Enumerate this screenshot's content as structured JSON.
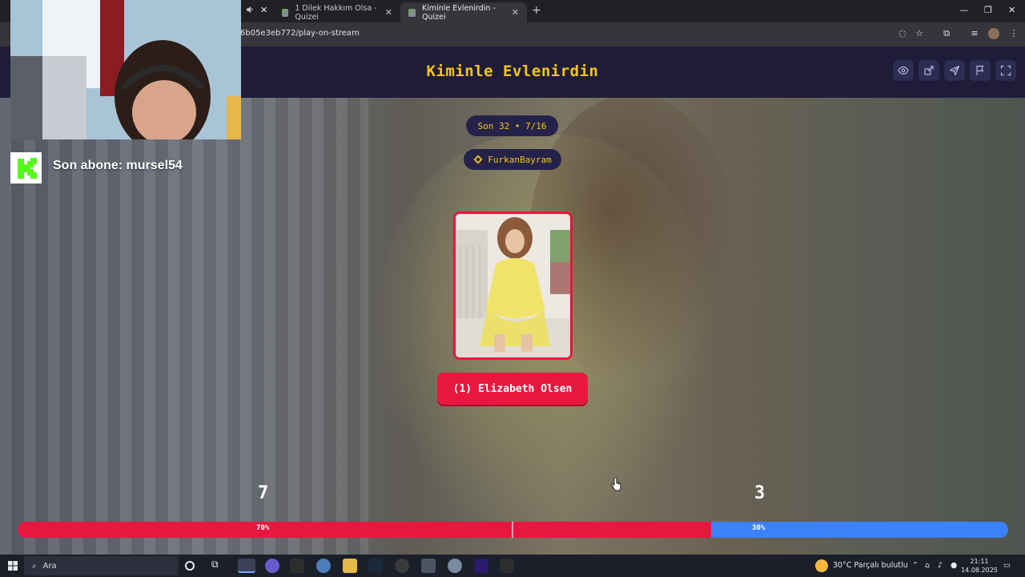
{
  "browser": {
    "tabs": [
      {
        "label": "1 Dilek Hakkım Olsa - Quizei",
        "active": false
      },
      {
        "label": "Kiminle Evlenirdin - Quizei",
        "active": true
      }
    ],
    "new_tab_symbol": "+",
    "url": "6b05e3eb772/play-on-stream",
    "window_controls": [
      "—",
      "❐",
      "✕"
    ]
  },
  "page": {
    "title": "Kiminle Evlenirdin",
    "round_pill": "Son 32 • 7/16",
    "user_pill": "FurkanBayram",
    "choice_label": "(1) Elizabeth Olsen",
    "header_icons": [
      "eye-icon",
      "share-icon",
      "send-icon",
      "flag-icon",
      "fullscreen-icon"
    ],
    "colors": {
      "accent": "#f5c518",
      "left": "#e8173f",
      "right": "#3b82f6",
      "header": "#1f1c3a"
    }
  },
  "vote": {
    "left_count": "7",
    "right_count": "3",
    "left_percent_label": "70%",
    "right_percent_label": "30%",
    "left_fraction": 0.7
  },
  "overlay": {
    "subscriber_text": "Son abone: mursel54"
  },
  "taskbar": {
    "search_placeholder": "Ara",
    "weather": "30°C  Parçalı bulutlu",
    "time": "21:11",
    "date": "14.08.2025"
  }
}
